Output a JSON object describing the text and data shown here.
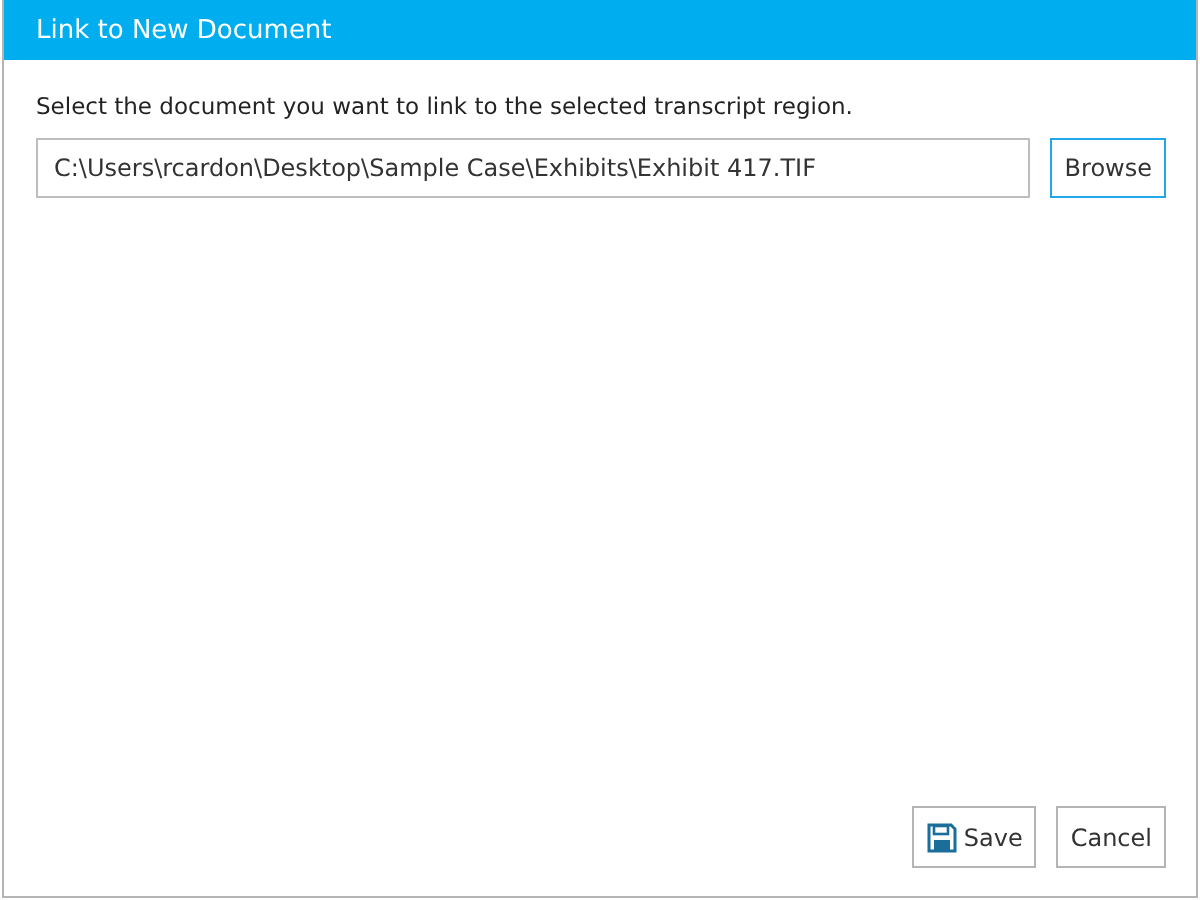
{
  "window": {
    "title": "Link to New Document"
  },
  "instruction": "Select the document you want to link to the selected transcript region.",
  "path_field": {
    "value": "C:\\Users\\rcardon\\Desktop\\Sample Case\\Exhibits\\Exhibit 417.TIF"
  },
  "browse_button": {
    "label": "Browse"
  },
  "buttons": [
    {
      "label": "Save",
      "kind": "save"
    },
    {
      "label": "Cancel",
      "kind": "plain"
    }
  ]
}
